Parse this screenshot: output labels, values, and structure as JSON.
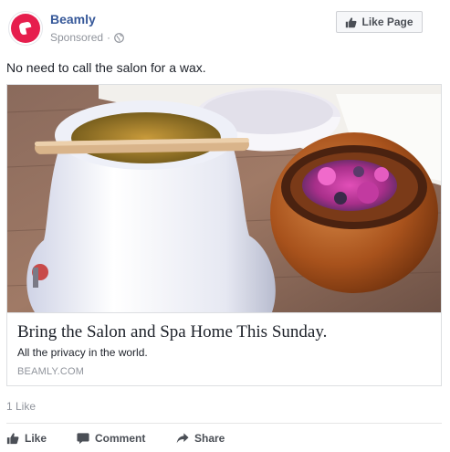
{
  "header": {
    "page_name": "Beamly",
    "sponsored": "Sponsored",
    "separator": "·",
    "like_page_label": "Like Page"
  },
  "post": {
    "text": "No need to call the salon for a wax."
  },
  "card": {
    "title": "Bring the Salon and Spa Home This Sunday.",
    "description": "All the privacy in the world.",
    "domain": "BEAMLY.COM"
  },
  "footer": {
    "like_count": "1 Like",
    "actions": {
      "like": "Like",
      "comment": "Comment",
      "share": "Share"
    }
  },
  "colors": {
    "brand": "#e61e4d",
    "link": "#365899",
    "muted": "#90949c"
  }
}
